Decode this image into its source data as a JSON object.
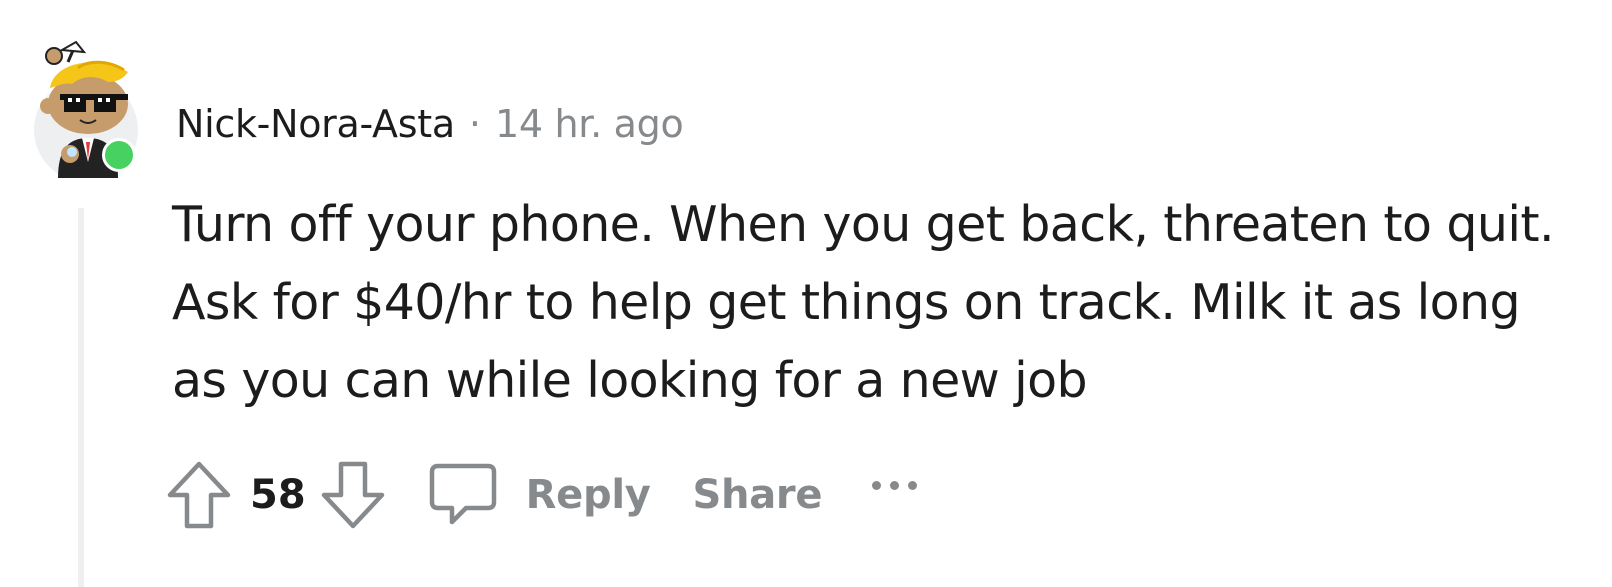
{
  "comment": {
    "author": "Nick-Nora-Asta",
    "separator": "·",
    "timestamp": "14 hr. ago",
    "body": "Turn off your phone. When you get back, threaten to quit. Ask for $40/hr to help get things on track. Milk it as long as you can while looking for a new job",
    "score": "58",
    "author_online": true
  },
  "actions": {
    "reply_label": "Reply",
    "share_label": "Share",
    "more_icon": "ellipsis-icon"
  },
  "icons": {
    "upvote": "upvote-arrow-icon",
    "downvote": "downvote-arrow-icon",
    "comment": "speech-bubble-icon",
    "avatar": "snoo-avatar-with-sunglasses"
  },
  "colors": {
    "text_primary": "#1c1c1c",
    "text_muted": "#878a8c",
    "online": "#46d160",
    "thread_line": "#edeff1"
  }
}
